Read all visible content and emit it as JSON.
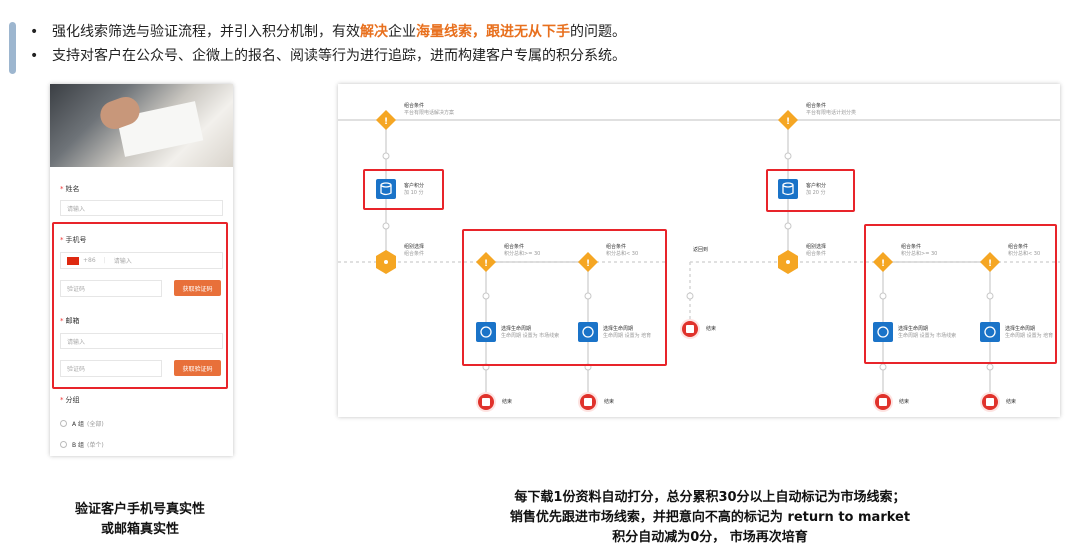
{
  "bullets": [
    {
      "parts": [
        {
          "text": "强化线索筛选与验证流程，并引入积分机制，有效",
          "hl": false
        },
        {
          "text": "解决",
          "hl": true
        },
        {
          "text": "企业",
          "hl": false
        },
        {
          "text": "海量线索，跟进无从下手",
          "hl": true
        },
        {
          "text": "的问题。",
          "hl": false
        }
      ]
    },
    {
      "parts": [
        {
          "text": "支持对客户在公众号、企微上的报名、阅读等行为进行追踪，进而构建客户专属的积分系统。",
          "hl": false
        }
      ]
    }
  ],
  "form": {
    "name_label": "姓名",
    "name_placeholder": "请输入",
    "phone_label": "手机号",
    "phone_code": "+86",
    "phone_placeholder": "请输入",
    "code_placeholder": "验证码",
    "get_code": "获取验证码",
    "email_label": "邮箱",
    "email_placeholder": "请输入",
    "email_code_placeholder": "验证码",
    "email_get_code": "获取验证码",
    "group_label": "分组",
    "options": [
      {
        "label": "A 组",
        "sub": "(全部)"
      },
      {
        "label": "B 组",
        "sub": "(单个)"
      }
    ]
  },
  "flow": {
    "nodes": {
      "cond_top1": {
        "title": "组合条件",
        "sub": "平台有限电话解决方案"
      },
      "cond_top2": {
        "title": "组合条件",
        "sub": "平台有限电话计划分类"
      },
      "score1": {
        "title": "客户积分",
        "sub": "加 10 分"
      },
      "score2": {
        "title": "客户积分",
        "sub": "加 20 分"
      },
      "branch1": {
        "title": "组别选择",
        "sub": "组合条件"
      },
      "branch2": {
        "title": "组别选择",
        "sub": "组合条件"
      },
      "cond_a": {
        "title": "组合条件",
        "sub": "积分总和>= 30"
      },
      "cond_b": {
        "title": "组合条件",
        "sub": "积分总和< 30"
      },
      "cond_c": {
        "title": "组合条件",
        "sub": "积分总和>= 30"
      },
      "cond_d": {
        "title": "组合条件",
        "sub": "积分总和< 30"
      },
      "life_a": {
        "title": "选择生命周期",
        "sub": "生命周期 设置为 市场线索"
      },
      "life_b": {
        "title": "选择生命周期",
        "sub": "生命周期 设置为 培育"
      },
      "life_c": {
        "title": "选择生命周期",
        "sub": "生命周期 设置为 市场线索"
      },
      "life_d": {
        "title": "选择生命周期",
        "sub": "生命周期 设置为 培育"
      },
      "end_mid": {
        "title": "结束"
      },
      "end_a": {
        "title": "结束"
      },
      "end_b": {
        "title": "结束"
      },
      "end_c": {
        "title": "结束"
      },
      "end_d": {
        "title": "结束"
      },
      "loop": {
        "title": "返回到"
      }
    },
    "colors": {
      "diamond": "#f5a623",
      "blue": "#1a73c8",
      "end": "#e0322b",
      "line": "#d0d0d0"
    }
  },
  "captions": {
    "left": [
      "验证客户手机号真实性",
      "或邮箱真实性"
    ],
    "right": [
      "每下载1份资料自动打分，总分累积30分以上自动标记为市场线索；",
      "销售优先跟进市场线索，并把意向不高的标记为 return to market",
      "积分自动减为0分， 市场再次培育"
    ]
  }
}
